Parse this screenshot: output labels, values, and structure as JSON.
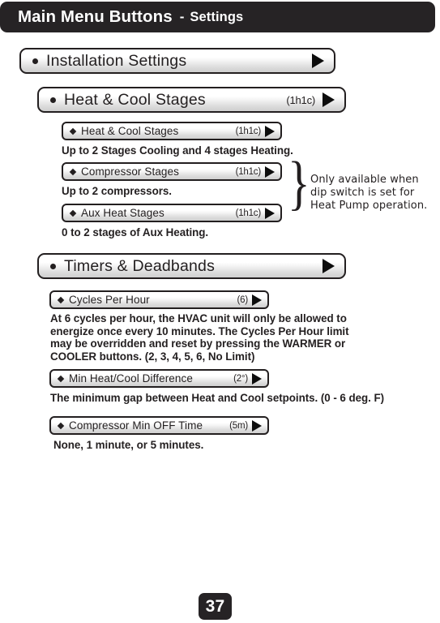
{
  "header": {
    "title": "Main Menu Buttons",
    "separator": "-",
    "subtitle": "Settings"
  },
  "sections": [
    {
      "button": {
        "label": "Installation Settings",
        "badge": "",
        "arrow": "triangle-right-icon"
      }
    },
    {
      "button": {
        "label": "Heat & Cool Stages",
        "badge": "(1h1c)",
        "arrow": "triangle-right-icon"
      },
      "sub_items": [
        {
          "label": "Heat & Cool Stages",
          "badge": "(1h1c)",
          "description": "Up to 2 Stages Cooling and 4 stages Heating."
        },
        {
          "label": "Compressor Stages",
          "badge": "(1h1c)",
          "description": "Up to 2 compressors."
        },
        {
          "label": "Aux Heat Stages",
          "badge": "(1h1c)",
          "description": "0 to 2 stages of Aux Heating."
        }
      ],
      "annotation": {
        "line1": "Only available when",
        "line2": "dip switch is set for",
        "line3": "Heat Pump operation."
      }
    },
    {
      "button": {
        "label": "Timers & Deadbands",
        "badge": "",
        "arrow": "triangle-right-icon"
      },
      "sub_items": [
        {
          "label": "Cycles Per Hour",
          "badge": "(6)",
          "description_line1": "At 6 cycles per hour, the HVAC unit will only be allowed to",
          "description_line2": "energize once every 10 minutes. The Cycles Per Hour limit",
          "description_line3": "may be overridden and reset by pressing the WARMER or",
          "description_line4": "COOLER buttons. (2, 3, 4, 5, 6, No Limit)"
        },
        {
          "label": "Min Heat/Cool Difference",
          "badge": "(2°)",
          "description": "The minimum gap between Heat and Cool setpoints. (0 - 6 deg. F)"
        },
        {
          "label": "Compressor Min OFF Time",
          "badge": "(5m)",
          "description": "None, 1 minute, or 5 minutes."
        }
      ]
    }
  ],
  "footer": {
    "page_number": "37"
  }
}
